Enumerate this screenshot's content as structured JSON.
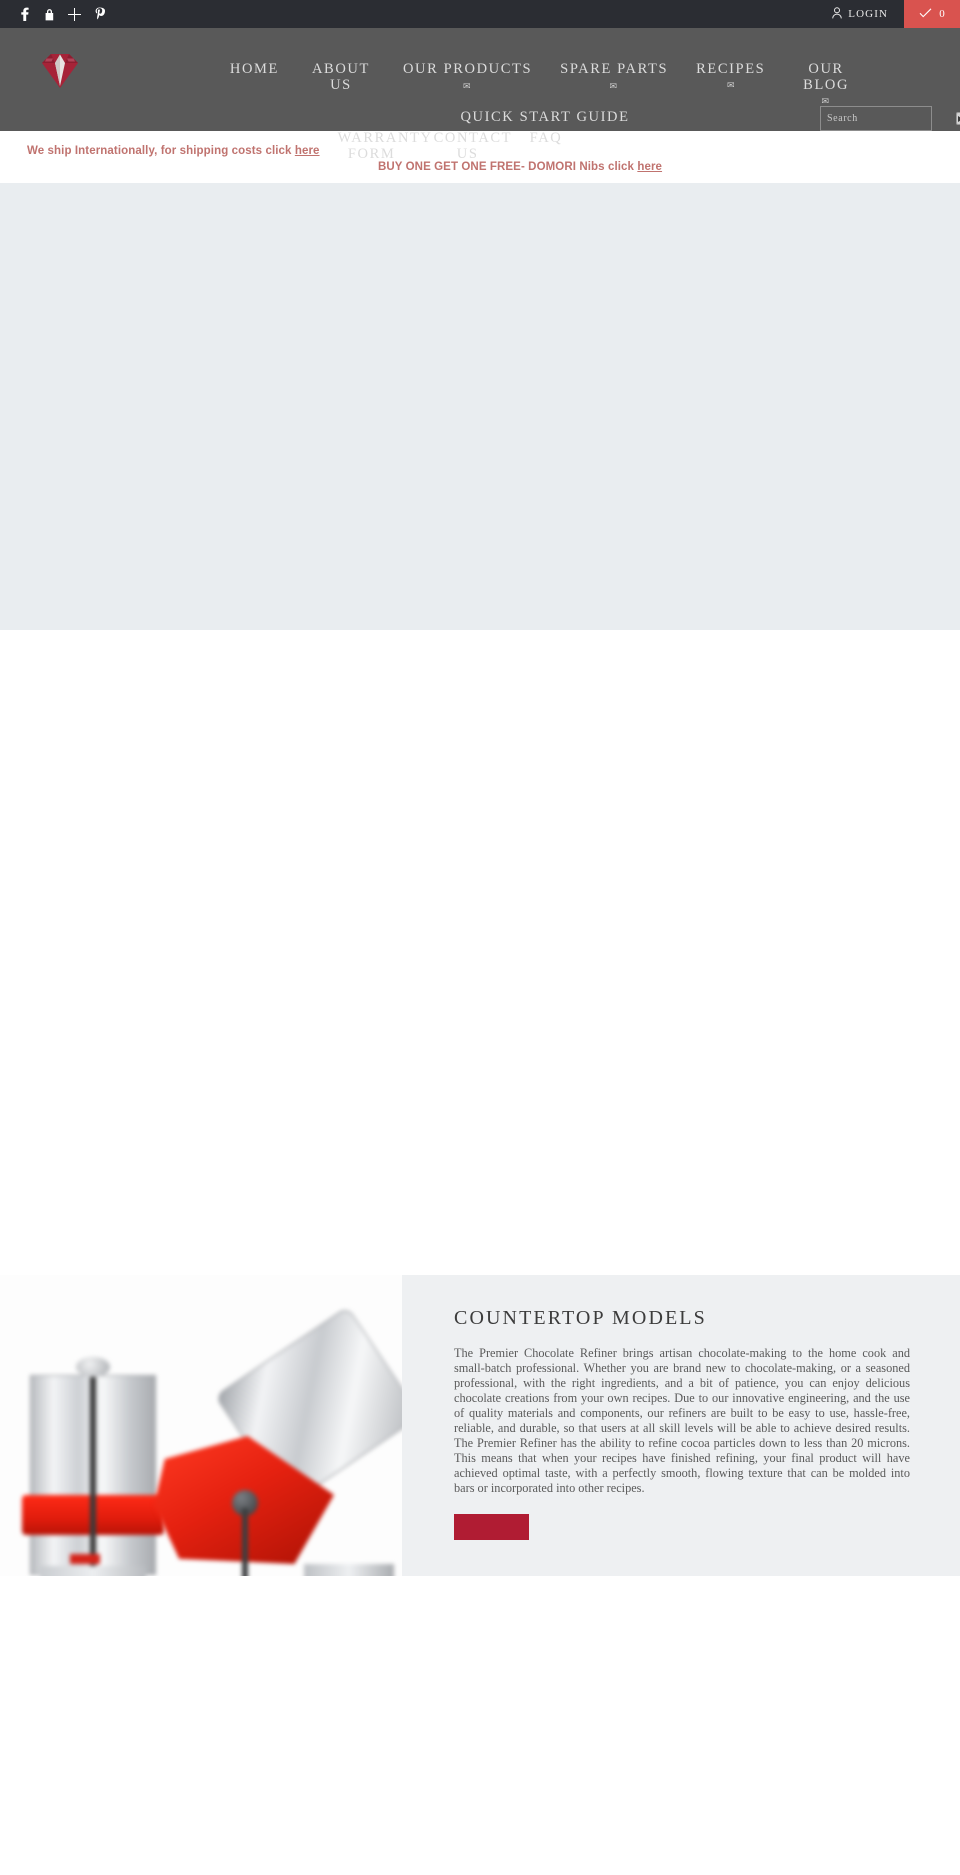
{
  "topbar": {
    "social": [
      {
        "name": "facebook-icon",
        "label": "f"
      },
      {
        "name": "lock-icon",
        "label": "lock"
      },
      {
        "name": "plus-icon",
        "label": "+"
      },
      {
        "name": "pinterest-icon",
        "label": "p"
      }
    ],
    "login_label": "LOGIN",
    "cart_count": "0",
    "colors": {
      "bar_bg": "#2b2d33",
      "cart_bg": "#d9534f"
    }
  },
  "header": {
    "logo_alt": "diamond-logo",
    "logo_color": "#a62338",
    "bg": "#595959",
    "nav_row_1": [
      {
        "label": "HOME",
        "caret": "",
        "wide": false,
        "below": false
      },
      {
        "label": "ABOUT US",
        "caret": "",
        "wide": false,
        "below": false
      },
      {
        "label": "OUR PRODUCTS",
        "caret": "✉",
        "wide": true,
        "below": true
      },
      {
        "label": "SPARE PARTS",
        "caret": "✉",
        "wide": true,
        "below": true
      },
      {
        "label": "RECIPES",
        "caret": "✉",
        "wide": false,
        "below": false
      },
      {
        "label": "OUR BLOG",
        "caret": "✉",
        "wide": false,
        "below": true
      },
      {
        "label": "QUICK START GUIDE",
        "caret": "",
        "wide": true,
        "below": false
      }
    ],
    "nav_row_2": [
      {
        "label": "WARRANTY FORM",
        "caret": "",
        "wide": false,
        "below": false
      },
      {
        "label": "CONTACT US",
        "caret": "",
        "wide": false,
        "below": false
      },
      {
        "label": "FAQ",
        "caret": "",
        "wide": false,
        "below": false
      }
    ],
    "search": {
      "placeholder": "Search",
      "value": "",
      "submit_name": "search-submit-button"
    }
  },
  "announcements": [
    {
      "text": "We ship Internationally, for shipping costs click ",
      "link": "here"
    },
    {
      "text": "BUY ONE GET ONE FREE- DOMORI Nibs click ",
      "link": "here"
    }
  ],
  "slideshow": {
    "bg": "#e9edf0"
  },
  "feature": {
    "title": "COUNTERTOP MODELS",
    "body": "The Premier Chocolate Refiner brings artisan chocolate-making to the home cook and small-batch professional. Whether you are brand new to chocolate-making, or a seasoned professional, with the right ingredients, and a bit of patience, you can enjoy delicious chocolate creations from your own recipes. Due to our innovative engineering, and the use of quality materials and components, our refiners are built to be easy to use, hassle-free, reliable, and durable, so that users at all skill levels will be able to achieve desired results. The Premier Refiner has the ability to refine cocoa particles down to less than 20 microns. This means that when your recipes have finished refining, your final product will have achieved optimal taste, with a perfectly smooth, flowing texture that can be molded into bars or incorporated into other recipes.",
    "button_label": "",
    "button_color": "#b01c33",
    "panel_bg": "#eef0f2"
  }
}
